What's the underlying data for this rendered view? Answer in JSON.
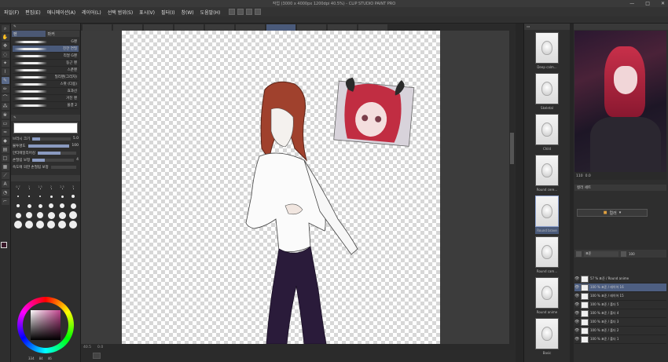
{
  "window": {
    "title": "작업 (3000 x 4000px 1200dpi 40.5%) - CLIP STUDIO PAINT PRO",
    "controls": [
      "—",
      "□",
      "✕"
    ]
  },
  "menu": [
    "파일(F)",
    "편집(E)",
    "애니메이션(A)",
    "레이어(L)",
    "선택 범위(S)",
    "표시(V)",
    "필터(I)",
    "창(W)",
    "도움말(H)"
  ],
  "left": {
    "tabs": [
      "펜",
      "마커"
    ],
    "brushes": [
      {
        "name": "G펜"
      },
      {
        "name": "진한 연필"
      },
      {
        "name": "리얼 G펜"
      },
      {
        "name": "둥근 펜"
      },
      {
        "name": "스푼펜"
      },
      {
        "name": "밀리펜(그리자)"
      },
      {
        "name": "스팟 (다용)"
      },
      {
        "name": "효과선"
      },
      {
        "name": "거친 펜"
      },
      {
        "name": "물결 2"
      }
    ],
    "props": [
      {
        "label": "브러시 크기",
        "value": "5.0",
        "fill": 0.2
      },
      {
        "label": "불투명도",
        "value": "100",
        "fill": 1.0
      },
      {
        "label": "안티에일리어싱",
        "value": "",
        "fill": 0.6
      },
      {
        "label": "손떨림 보정",
        "value": "4",
        "fill": 0.3
      },
      {
        "label": "속도에 의한 손떨림 보정",
        "value": "",
        "fill": 0
      }
    ],
    "sizes": [
      {
        "label": "0.7",
        "d": 1
      },
      {
        "label": "1",
        "d": 1
      },
      {
        "label": "1.5",
        "d": 1
      },
      {
        "label": "2",
        "d": 1
      },
      {
        "label": "2.5",
        "d": 1
      },
      {
        "label": "3",
        "d": 1
      },
      {
        "label": "4",
        "d": 2
      },
      {
        "label": "5",
        "d": 2
      },
      {
        "label": "6",
        "d": 2
      },
      {
        "label": "7",
        "d": 3
      },
      {
        "label": "8",
        "d": 3
      },
      {
        "label": "10",
        "d": 4
      },
      {
        "label": "12",
        "d": 4
      },
      {
        "label": "15",
        "d": 5
      },
      {
        "label": "17",
        "d": 5
      },
      {
        "label": "20",
        "d": 6
      },
      {
        "label": "25",
        "d": 6
      },
      {
        "label": "30",
        "d": 7
      },
      {
        "label": "40",
        "d": 7
      },
      {
        "label": "50",
        "d": 8
      },
      {
        "label": "60",
        "d": 8
      },
      {
        "label": "70",
        "d": 9
      },
      {
        "label": "80",
        "d": 9
      },
      {
        "label": "100",
        "d": 10
      },
      {
        "label": "120",
        "d": 10
      },
      {
        "label": "150",
        "d": 10
      },
      {
        "label": "170",
        "d": 10
      },
      {
        "label": "200",
        "d": 10
      },
      {
        "label": "250",
        "d": 10
      },
      {
        "label": "300",
        "d": 10
      }
    ],
    "color_values": [
      "334",
      "84",
      "46"
    ]
  },
  "canvas": {
    "zoom": "40.5",
    "status_items": [
      "40.5",
      "0.0"
    ]
  },
  "poses": [
    {
      "label": "Deep calm..."
    },
    {
      "label": "Skeletal"
    },
    {
      "label": "Child"
    },
    {
      "label": "Round cere..."
    },
    {
      "label": "Round brave",
      "selected": true
    },
    {
      "label": "Round cam..."
    },
    {
      "label": "Round anime"
    },
    {
      "label": "Basic"
    }
  ],
  "navigator": {
    "zoom": "110",
    "angle": "0.0"
  },
  "color_set": {
    "title": "컬러 세트",
    "selected": "컬러"
  },
  "layers": {
    "blend": "표준",
    "opacity": "100",
    "items": [
      {
        "name": "57 % 표준 / Round anime",
        "selected": false
      },
      {
        "name": "100 % 표준 / 레이어 16",
        "selected": true
      },
      {
        "name": "100 % 표준 / 레이어 15",
        "selected": false
      },
      {
        "name": "100 % 표준 / 폴더 5",
        "selected": false
      },
      {
        "name": "100 % 표준 / 폴더 4",
        "selected": false
      },
      {
        "name": "100 % 표준 / 폴더 3",
        "selected": false
      },
      {
        "name": "100 % 표준 / 폴더 2",
        "selected": false
      },
      {
        "name": "100 % 표준 / 폴더 1",
        "selected": false
      }
    ]
  }
}
